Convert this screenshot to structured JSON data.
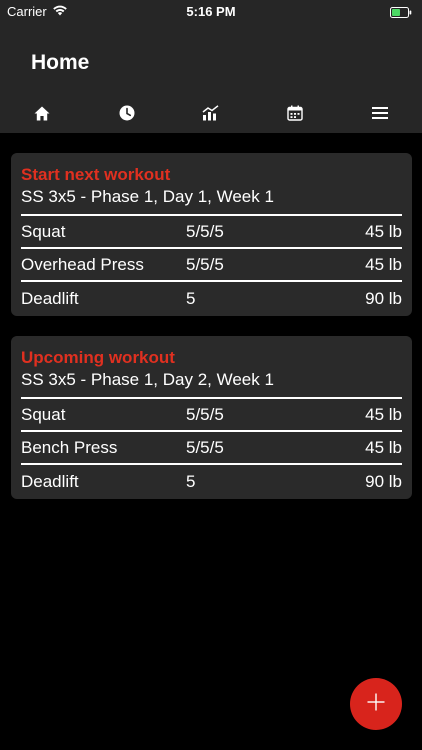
{
  "status_bar": {
    "carrier": "Carrier",
    "time": "5:16 PM"
  },
  "header": {
    "title": "Home"
  },
  "tabs": [
    {
      "icon": "home-icon",
      "active": true
    },
    {
      "icon": "clock-icon",
      "active": false
    },
    {
      "icon": "chart-icon",
      "active": false
    },
    {
      "icon": "calendar-icon",
      "active": false
    },
    {
      "icon": "menu-icon",
      "active": false
    }
  ],
  "next_workout": {
    "title": "Start next workout",
    "subtitle": "SS 3x5 - Phase 1, Day 1, Week 1",
    "exercises": [
      {
        "name": "Squat",
        "sets": "5/5/5",
        "weight": "45 lb"
      },
      {
        "name": "Overhead Press",
        "sets": "5/5/5",
        "weight": "45 lb"
      },
      {
        "name": "Deadlift",
        "sets": "5",
        "weight": "90 lb"
      }
    ]
  },
  "upcoming_workout": {
    "title": "Upcoming workout",
    "subtitle": "SS 3x5 - Phase 1, Day 2, Week 1",
    "exercises": [
      {
        "name": "Squat",
        "sets": "5/5/5",
        "weight": "45 lb"
      },
      {
        "name": "Bench Press",
        "sets": "5/5/5",
        "weight": "45 lb"
      },
      {
        "name": "Deadlift",
        "sets": "5",
        "weight": "90 lb"
      }
    ]
  },
  "colors": {
    "accent": "#e03020",
    "fab": "#d8241c",
    "header_bg": "#262626",
    "card_bg": "#2a2a2a",
    "battery": "#4cd964"
  }
}
